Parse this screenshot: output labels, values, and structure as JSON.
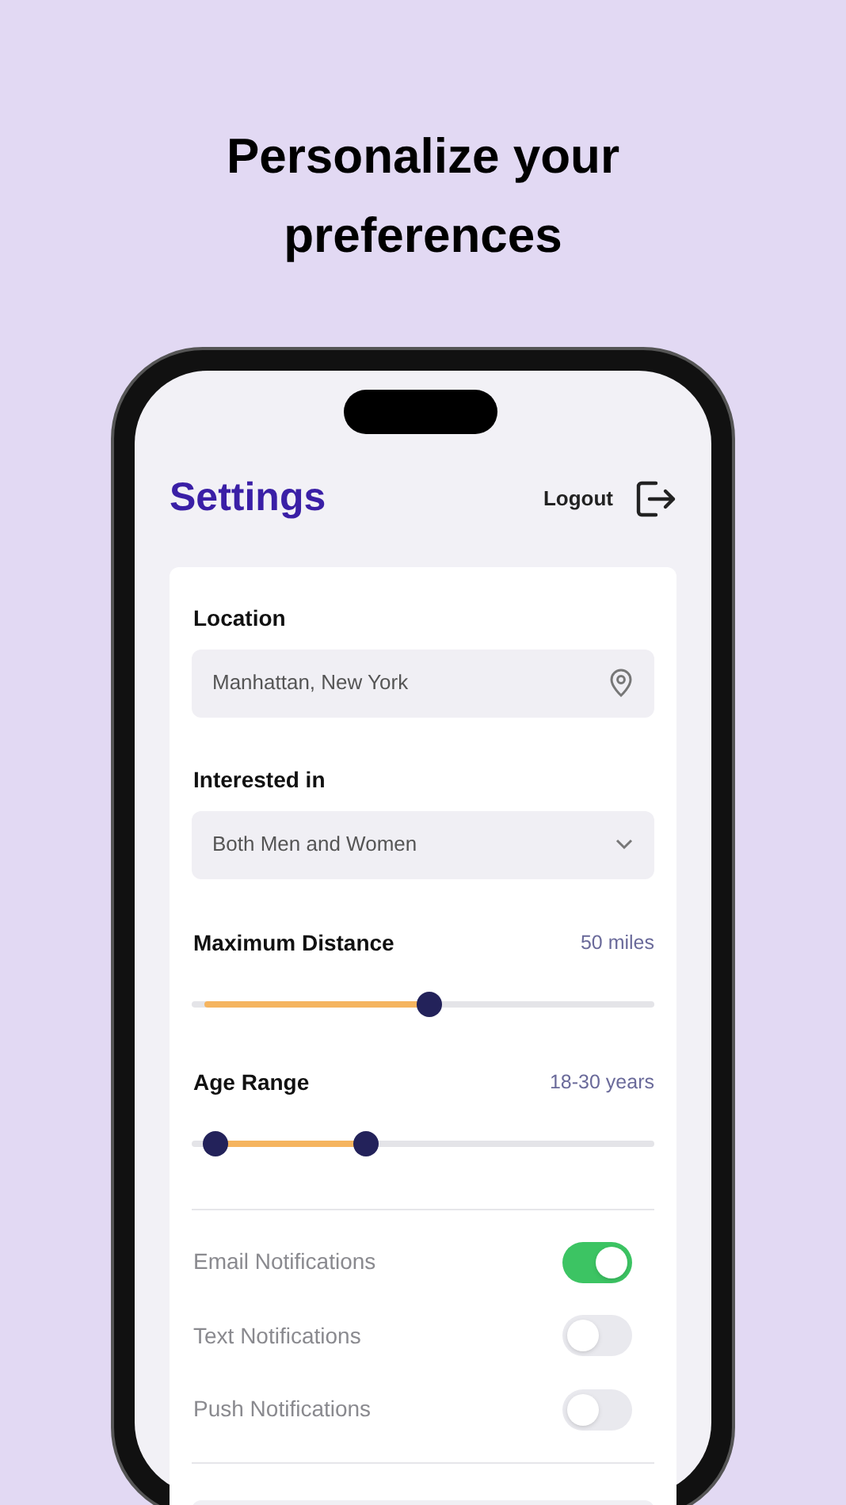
{
  "headline": "Personalize your preferences",
  "header": {
    "title": "Settings",
    "logout": "Logout"
  },
  "location": {
    "label": "Location",
    "value": "Manhattan, New York"
  },
  "interest": {
    "label": "Interested in",
    "value": "Both Men and Women"
  },
  "distance": {
    "label": "Maximum Distance",
    "reading": "50 miles",
    "level": 0.515
  },
  "age": {
    "label": "Age Range",
    "reading": "18-30 years",
    "thumbs": [
      {
        "level": 0.025
      },
      {
        "level": 0.37
      }
    ]
  },
  "notifications": [
    {
      "label": "Email Notifications",
      "on": true
    },
    {
      "label": "Text Notifications",
      "on": false
    },
    {
      "label": "Push Notifications",
      "on": false
    }
  ]
}
